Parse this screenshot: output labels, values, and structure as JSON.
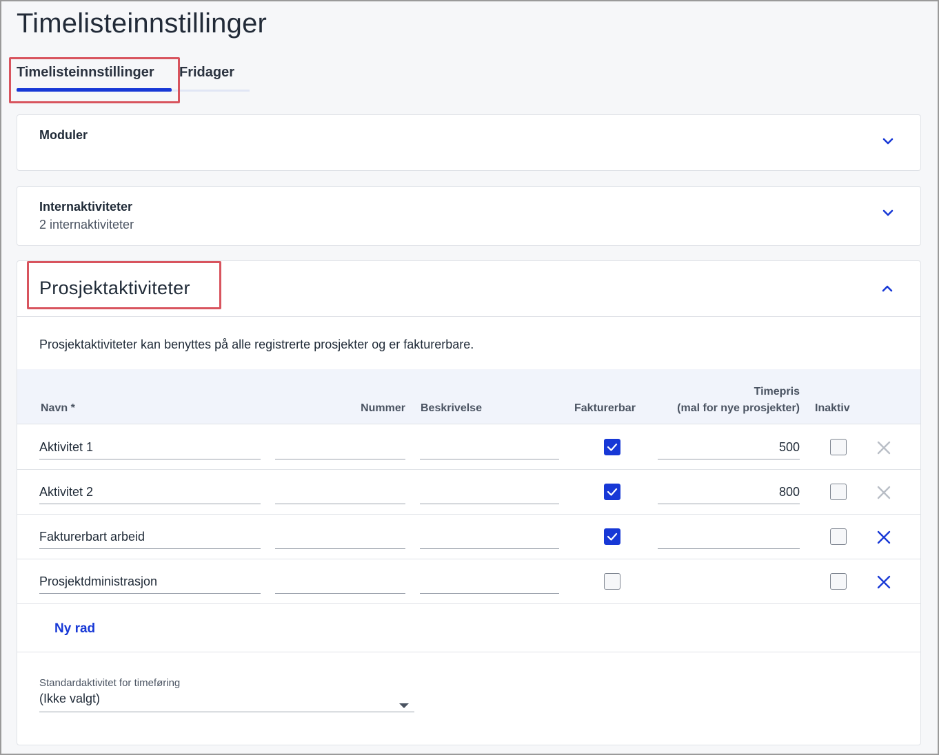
{
  "page": {
    "title": "Timelisteinnstillinger"
  },
  "tabs": [
    {
      "label": "Timelisteinnstillinger",
      "active": true
    },
    {
      "label": "Fridager",
      "active": false
    }
  ],
  "sections": {
    "modules": {
      "title": "Moduler",
      "icon": "chevron-down-icon"
    },
    "internal": {
      "title": "Internaktiviteter",
      "subtitle": "2 internaktiviteter",
      "icon": "chevron-down-icon"
    },
    "project": {
      "title": "Prosjektaktiviteter",
      "icon": "chevron-up-icon",
      "description": "Prosjektaktiviteter kan benyttes på alle registrerte prosjekter og er fakturerbare."
    }
  },
  "table": {
    "headers": {
      "name": "Navn *",
      "number": "Nummer",
      "description": "Beskrivelse",
      "billable": "Fakturerbar",
      "rate_line1": "Timepris",
      "rate_line2": "(mal for nye prosjekter)",
      "inactive": "Inaktiv"
    },
    "rows": [
      {
        "name": "Aktivitet 1",
        "number": "",
        "description": "",
        "billable": true,
        "rate": "500",
        "rate_editable": true,
        "inactive": false,
        "deletable": false
      },
      {
        "name": "Aktivitet 2",
        "number": "",
        "description": "",
        "billable": true,
        "rate": "800",
        "rate_editable": true,
        "inactive": false,
        "deletable": false
      },
      {
        "name": "Fakturerbart arbeid",
        "number": "",
        "description": "",
        "billable": true,
        "rate": "",
        "rate_editable": true,
        "inactive": false,
        "deletable": true
      },
      {
        "name": "Prosjektdministrasjon",
        "number": "",
        "description": "",
        "billable": false,
        "rate": "",
        "rate_editable": false,
        "inactive": false,
        "deletable": true
      }
    ],
    "new_row_label": "Ny rad"
  },
  "default_activity": {
    "label": "Standardaktivitet for timeføring",
    "value": "(Ikke valgt)"
  },
  "colors": {
    "accent": "#1738d6",
    "highlight_box": "#d8545e",
    "disabled_icon": "#b9bec6"
  }
}
